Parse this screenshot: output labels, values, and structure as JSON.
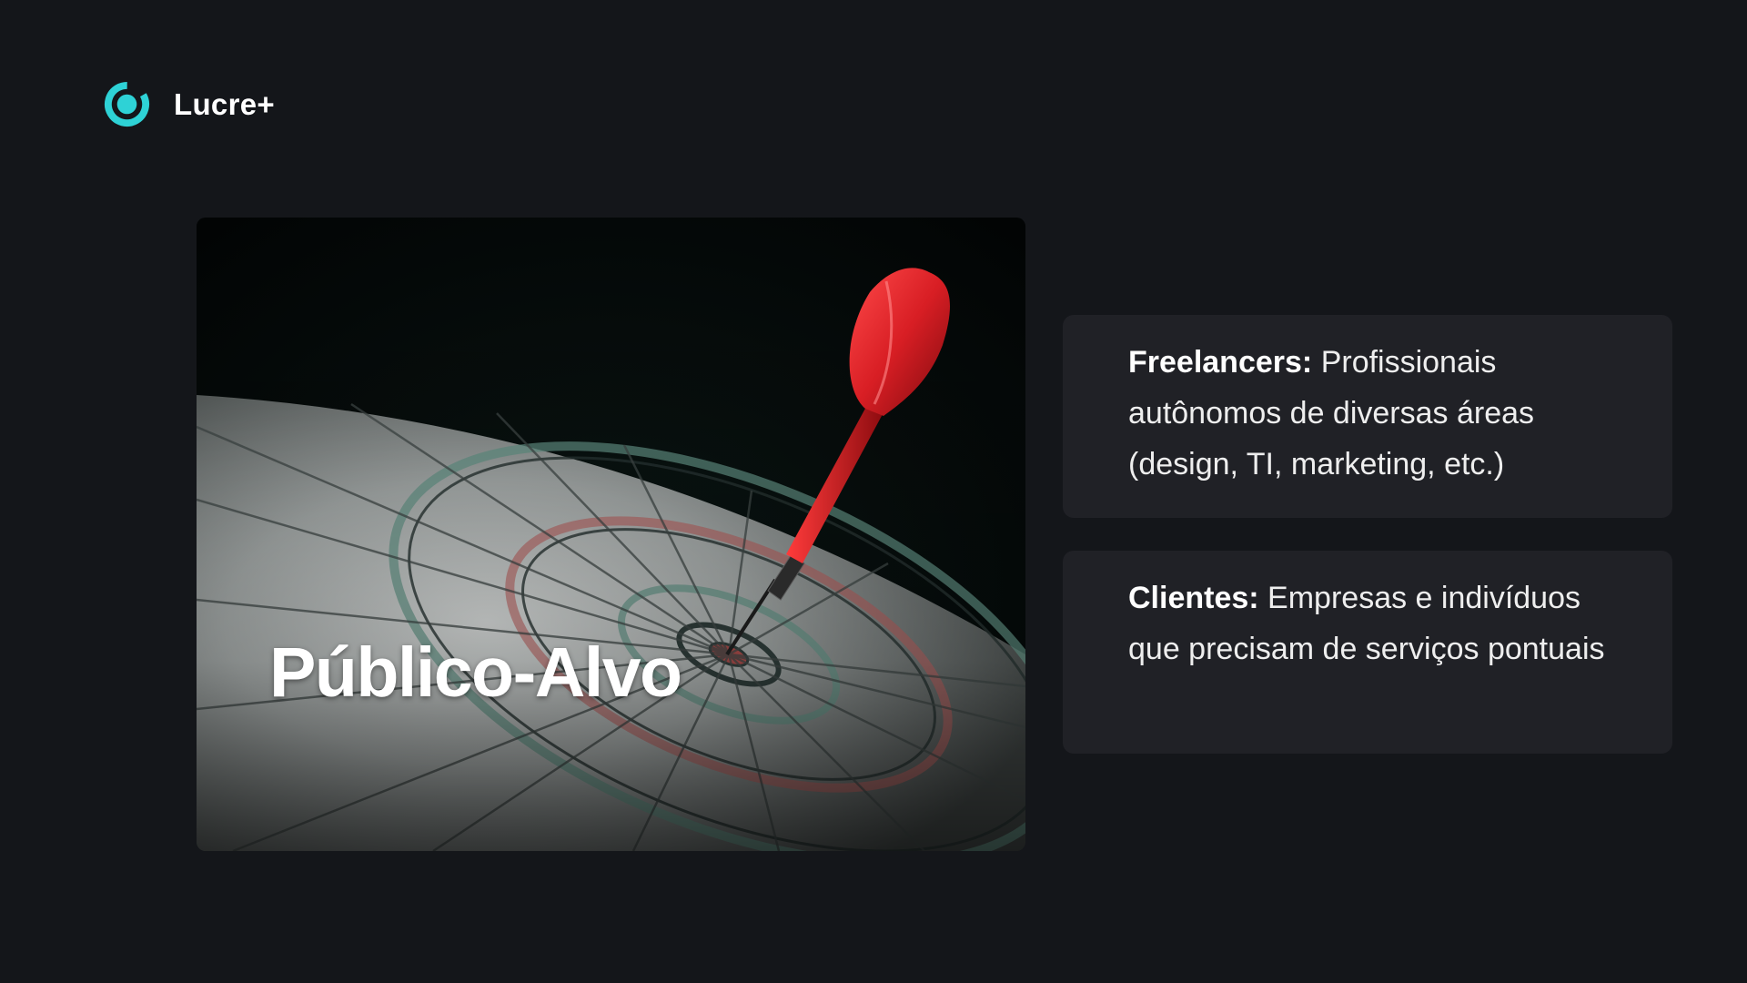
{
  "brand": {
    "name": "Lucre+",
    "logo_icon": "ring-logo-icon",
    "accent_color": "#2ed2d6"
  },
  "hero": {
    "title": "Público-Alvo",
    "image": "dartboard-with-red-dart-image"
  },
  "audience": [
    {
      "term": "Freelancers:",
      "description": "Profissionais autônomos de diversas áreas (design, TI, marketing, etc.)"
    },
    {
      "term": "Clientes:",
      "description": "Empresas e indivíduos que precisam de serviços pontuais"
    }
  ],
  "colors": {
    "background": "#14161a",
    "card": "#202126",
    "dart": "#d81e24"
  }
}
